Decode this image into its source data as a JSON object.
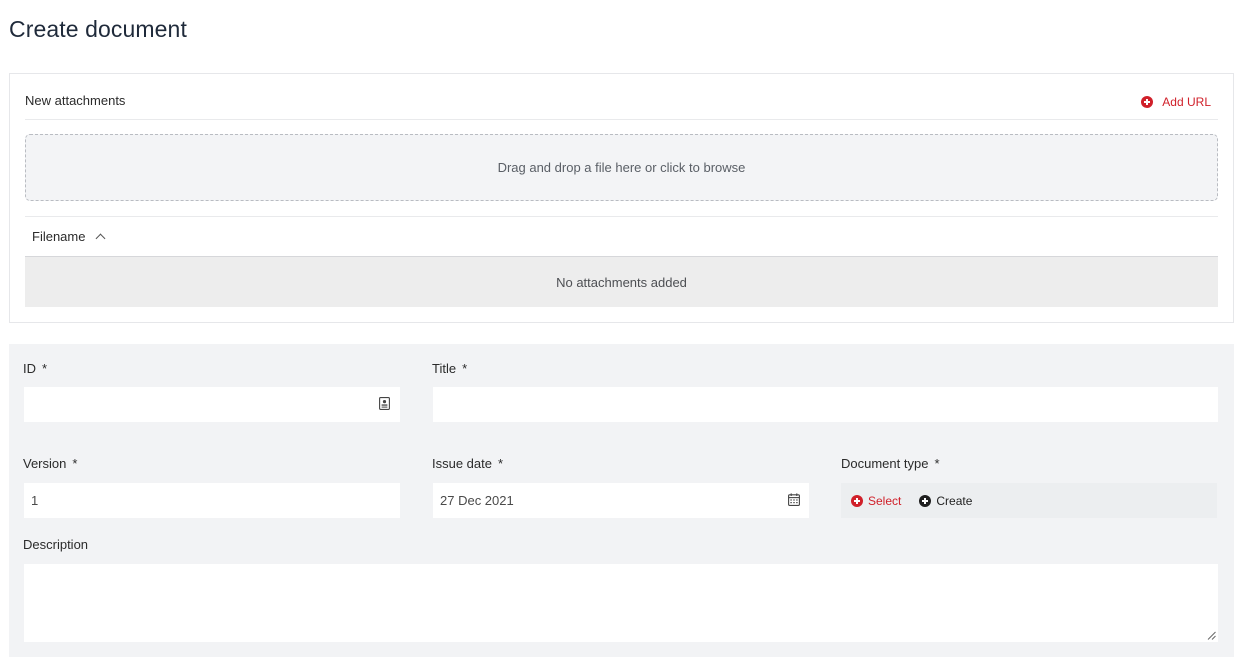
{
  "page": {
    "title": "Create document"
  },
  "attachments": {
    "section_title": "New attachments",
    "add_url_label": "Add URL",
    "dropzone_text": "Drag and drop a file here or click to browse",
    "table": {
      "columns": [
        "Filename"
      ],
      "empty_text": "No attachments added"
    }
  },
  "form": {
    "required_marker": "*",
    "id": {
      "label": "ID",
      "value": ""
    },
    "title": {
      "label": "Title",
      "value": ""
    },
    "version": {
      "label": "Version",
      "value": "1"
    },
    "issue_date": {
      "label": "Issue date",
      "value": "27 Dec 2021"
    },
    "document_type": {
      "label": "Document type",
      "select_label": "Select",
      "create_label": "Create"
    },
    "description": {
      "label": "Description",
      "value": ""
    }
  },
  "colors": {
    "accent": "#d0202a",
    "form_bg": "#f2f3f5",
    "text": "#2b2b2b"
  },
  "icons": [
    "plus-circle-icon",
    "chevron-up-icon",
    "id-card-icon",
    "calendar-icon",
    "resize-grip-icon"
  ]
}
